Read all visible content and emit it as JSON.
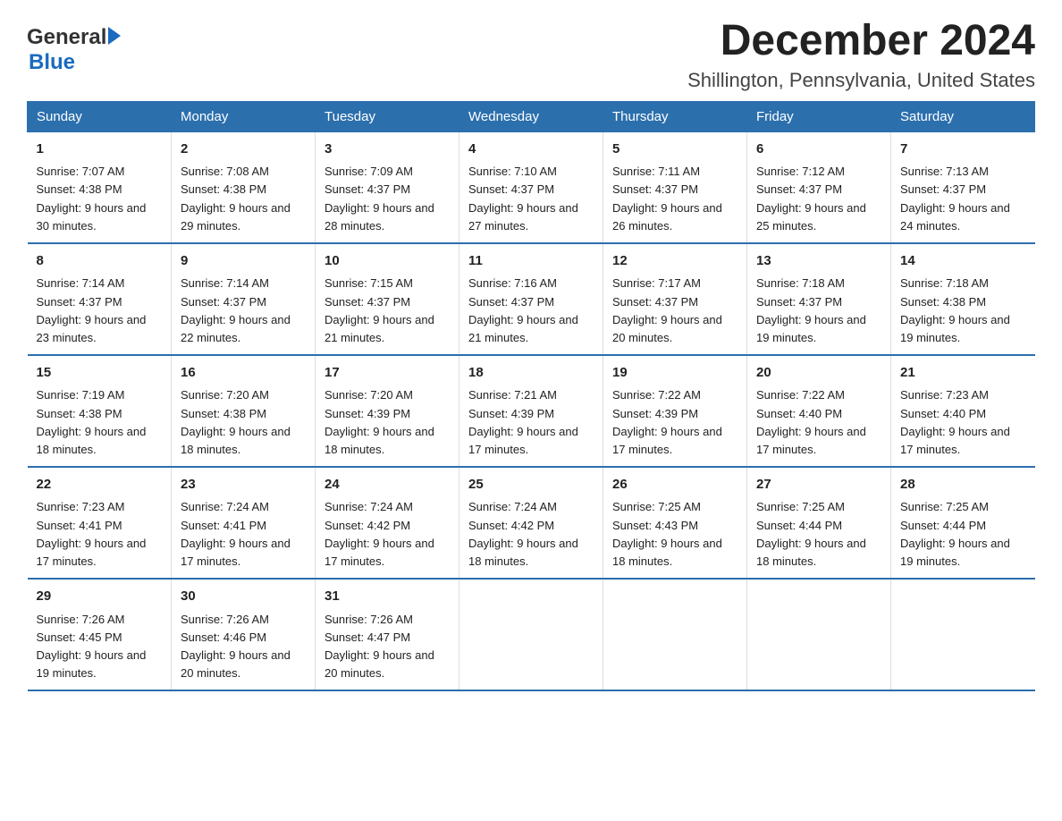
{
  "logo": {
    "general": "General",
    "blue": "Blue",
    "alt": "GeneralBlue logo"
  },
  "title": "December 2024",
  "subtitle": "Shillington, Pennsylvania, United States",
  "days_of_week": [
    "Sunday",
    "Monday",
    "Tuesday",
    "Wednesday",
    "Thursday",
    "Friday",
    "Saturday"
  ],
  "weeks": [
    [
      {
        "day": "1",
        "sunrise": "7:07 AM",
        "sunset": "4:38 PM",
        "daylight": "9 hours and 30 minutes."
      },
      {
        "day": "2",
        "sunrise": "7:08 AM",
        "sunset": "4:38 PM",
        "daylight": "9 hours and 29 minutes."
      },
      {
        "day": "3",
        "sunrise": "7:09 AM",
        "sunset": "4:37 PM",
        "daylight": "9 hours and 28 minutes."
      },
      {
        "day": "4",
        "sunrise": "7:10 AM",
        "sunset": "4:37 PM",
        "daylight": "9 hours and 27 minutes."
      },
      {
        "day": "5",
        "sunrise": "7:11 AM",
        "sunset": "4:37 PM",
        "daylight": "9 hours and 26 minutes."
      },
      {
        "day": "6",
        "sunrise": "7:12 AM",
        "sunset": "4:37 PM",
        "daylight": "9 hours and 25 minutes."
      },
      {
        "day": "7",
        "sunrise": "7:13 AM",
        "sunset": "4:37 PM",
        "daylight": "9 hours and 24 minutes."
      }
    ],
    [
      {
        "day": "8",
        "sunrise": "7:14 AM",
        "sunset": "4:37 PM",
        "daylight": "9 hours and 23 minutes."
      },
      {
        "day": "9",
        "sunrise": "7:14 AM",
        "sunset": "4:37 PM",
        "daylight": "9 hours and 22 minutes."
      },
      {
        "day": "10",
        "sunrise": "7:15 AM",
        "sunset": "4:37 PM",
        "daylight": "9 hours and 21 minutes."
      },
      {
        "day": "11",
        "sunrise": "7:16 AM",
        "sunset": "4:37 PM",
        "daylight": "9 hours and 21 minutes."
      },
      {
        "day": "12",
        "sunrise": "7:17 AM",
        "sunset": "4:37 PM",
        "daylight": "9 hours and 20 minutes."
      },
      {
        "day": "13",
        "sunrise": "7:18 AM",
        "sunset": "4:37 PM",
        "daylight": "9 hours and 19 minutes."
      },
      {
        "day": "14",
        "sunrise": "7:18 AM",
        "sunset": "4:38 PM",
        "daylight": "9 hours and 19 minutes."
      }
    ],
    [
      {
        "day": "15",
        "sunrise": "7:19 AM",
        "sunset": "4:38 PM",
        "daylight": "9 hours and 18 minutes."
      },
      {
        "day": "16",
        "sunrise": "7:20 AM",
        "sunset": "4:38 PM",
        "daylight": "9 hours and 18 minutes."
      },
      {
        "day": "17",
        "sunrise": "7:20 AM",
        "sunset": "4:39 PM",
        "daylight": "9 hours and 18 minutes."
      },
      {
        "day": "18",
        "sunrise": "7:21 AM",
        "sunset": "4:39 PM",
        "daylight": "9 hours and 17 minutes."
      },
      {
        "day": "19",
        "sunrise": "7:22 AM",
        "sunset": "4:39 PM",
        "daylight": "9 hours and 17 minutes."
      },
      {
        "day": "20",
        "sunrise": "7:22 AM",
        "sunset": "4:40 PM",
        "daylight": "9 hours and 17 minutes."
      },
      {
        "day": "21",
        "sunrise": "7:23 AM",
        "sunset": "4:40 PM",
        "daylight": "9 hours and 17 minutes."
      }
    ],
    [
      {
        "day": "22",
        "sunrise": "7:23 AM",
        "sunset": "4:41 PM",
        "daylight": "9 hours and 17 minutes."
      },
      {
        "day": "23",
        "sunrise": "7:24 AM",
        "sunset": "4:41 PM",
        "daylight": "9 hours and 17 minutes."
      },
      {
        "day": "24",
        "sunrise": "7:24 AM",
        "sunset": "4:42 PM",
        "daylight": "9 hours and 17 minutes."
      },
      {
        "day": "25",
        "sunrise": "7:24 AM",
        "sunset": "4:42 PM",
        "daylight": "9 hours and 18 minutes."
      },
      {
        "day": "26",
        "sunrise": "7:25 AM",
        "sunset": "4:43 PM",
        "daylight": "9 hours and 18 minutes."
      },
      {
        "day": "27",
        "sunrise": "7:25 AM",
        "sunset": "4:44 PM",
        "daylight": "9 hours and 18 minutes."
      },
      {
        "day": "28",
        "sunrise": "7:25 AM",
        "sunset": "4:44 PM",
        "daylight": "9 hours and 19 minutes."
      }
    ],
    [
      {
        "day": "29",
        "sunrise": "7:26 AM",
        "sunset": "4:45 PM",
        "daylight": "9 hours and 19 minutes."
      },
      {
        "day": "30",
        "sunrise": "7:26 AM",
        "sunset": "4:46 PM",
        "daylight": "9 hours and 20 minutes."
      },
      {
        "day": "31",
        "sunrise": "7:26 AM",
        "sunset": "4:47 PM",
        "daylight": "9 hours and 20 minutes."
      },
      null,
      null,
      null,
      null
    ]
  ],
  "labels": {
    "sunrise": "Sunrise:",
    "sunset": "Sunset:",
    "daylight": "Daylight:"
  }
}
